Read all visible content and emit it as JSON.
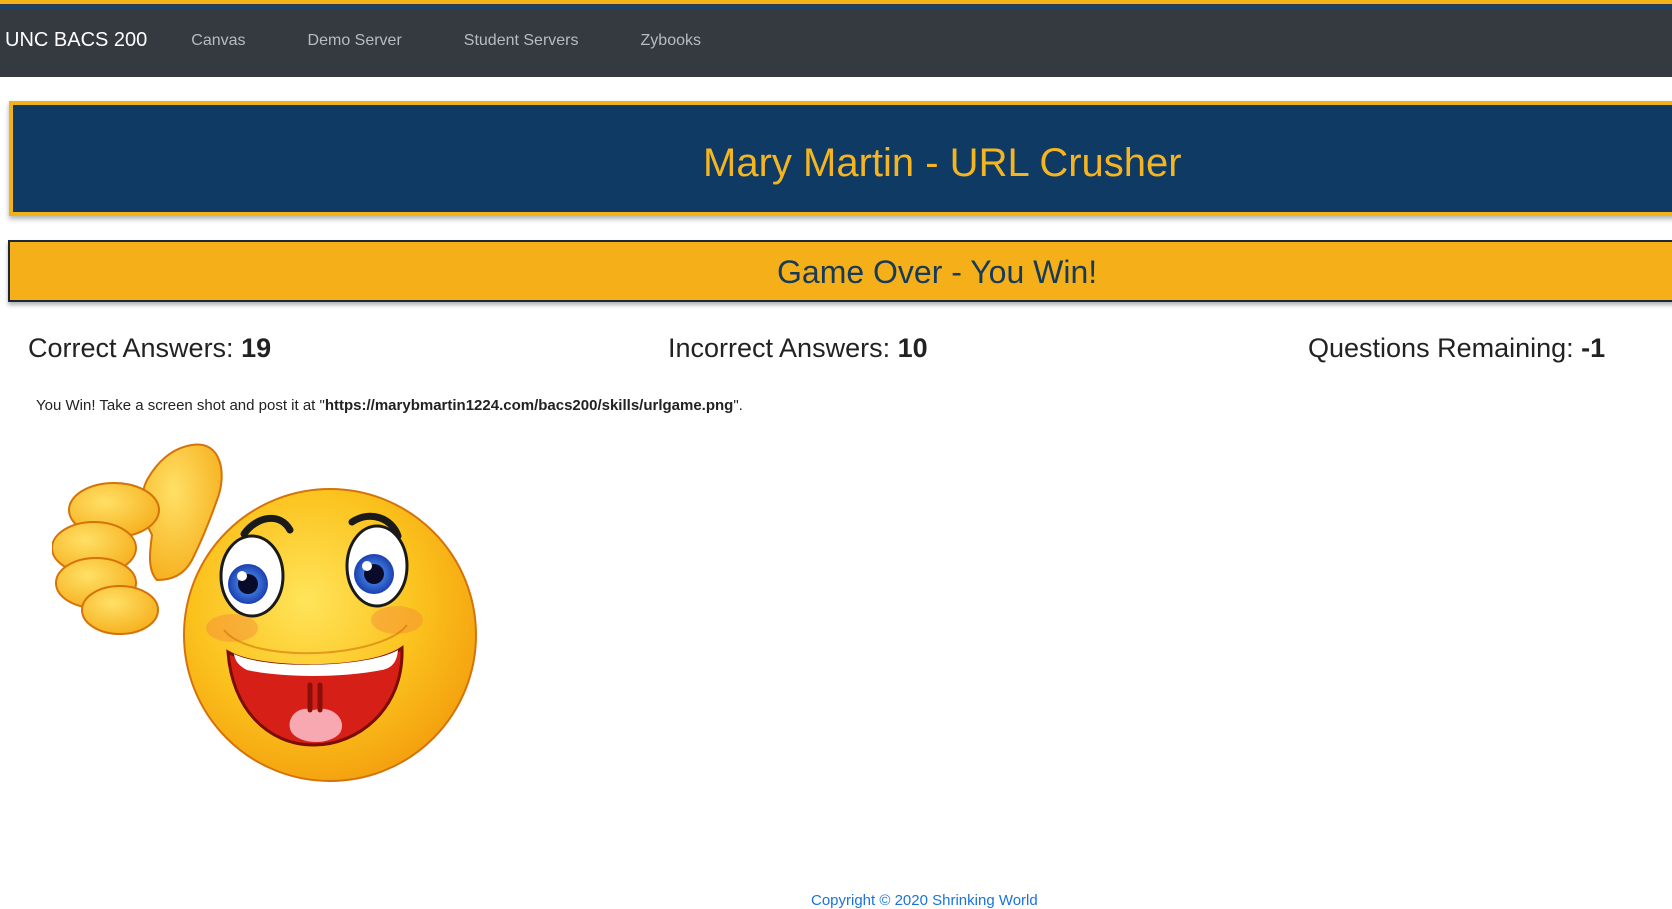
{
  "navbar": {
    "brand": "UNC BACS 200",
    "links": [
      "Canvas",
      "Demo Server",
      "Student Servers",
      "Zybooks"
    ]
  },
  "header": {
    "title": "Mary Martin - URL Crusher"
  },
  "status": {
    "text": "Game Over - You Win!"
  },
  "stats": {
    "correct_label": "Correct Answers: ",
    "correct_value": "19",
    "incorrect_label": "Incorrect Answers: ",
    "incorrect_value": "10",
    "remaining_label": "Questions Remaining: ",
    "remaining_value": "-1"
  },
  "message": {
    "prefix": "You Win! Take a screen shot and post it at \"",
    "url": "https://marybmartin1224.com/bacs200/skills/urlgame.png",
    "suffix": "\"."
  },
  "image": {
    "icon": "thumbs-up-smiley"
  },
  "footer": {
    "copyright": "Copyright © 2020 Shrinking World"
  },
  "colors": {
    "navbar": "#343a40",
    "banner_blue": "#0e3a64",
    "accent_gold": "#f5b019",
    "link_blue": "#1a73d9"
  }
}
